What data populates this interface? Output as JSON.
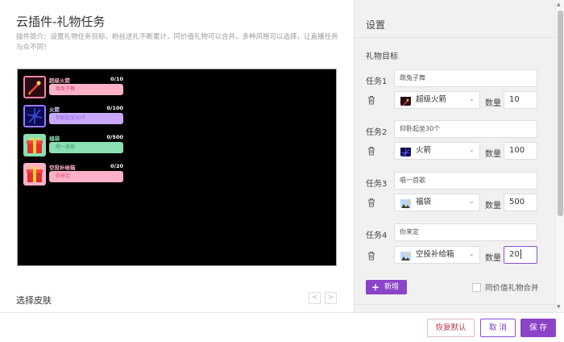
{
  "plugin": {
    "title": "云插件-礼物任务",
    "intro": "插件简介：设置礼物任务目标，粉丝送礼不断累计，同价值礼物可以合并。多种风格可以选择，让直播任务与众不同！"
  },
  "preview": {
    "items": [
      {
        "name": "超级火箭",
        "count": "0/10",
        "task": "跳兔子舞",
        "bar_color": "#ffb1c8",
        "icon": "rocket-icon"
      },
      {
        "name": "火箭",
        "count": "0/100",
        "task": "仰卧起坐30个",
        "bar_color": "#c8a9ff",
        "icon": "firework-icon"
      },
      {
        "name": "福袋",
        "count": "0/500",
        "task": "唱一首歌",
        "bar_color": "#8be0b3",
        "icon": "giftbox-icon"
      },
      {
        "name": "空投补给箱",
        "count": "0/20",
        "task": "你来定",
        "bar_color": "#ffb1c8",
        "icon": "supplybox-icon"
      }
    ]
  },
  "skin": {
    "label": "选择皮肤",
    "prev": "<",
    "next": ">"
  },
  "settings": {
    "title": "设置",
    "gift_target_label": "礼物目标",
    "qty_label": "数量",
    "tasks": [
      {
        "label": "任务1",
        "text": "跳兔子舞",
        "gift": "超级火箭",
        "qty": "10"
      },
      {
        "label": "任务2",
        "text": "仰卧起坐30个",
        "gift": "火箭",
        "qty": "100"
      },
      {
        "label": "任务3",
        "text": "唱一首歌",
        "gift": "福袋",
        "qty": "500"
      },
      {
        "label": "任务4",
        "text": "你来定",
        "gift": "空投补给箱",
        "qty": "20"
      }
    ],
    "add_label": "新增",
    "merge_label": "同价值礼物合并"
  },
  "footer": {
    "reset": "恢复默认",
    "cancel": "取 消",
    "save": "保 存"
  },
  "colors": {
    "accent": "#8b43c8",
    "danger": "#c0394c"
  }
}
